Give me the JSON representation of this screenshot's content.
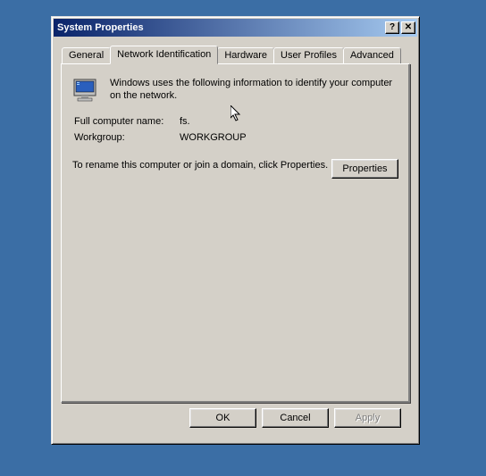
{
  "window": {
    "title": "System Properties"
  },
  "tabs": {
    "general": "General",
    "network": "Network Identification",
    "hardware": "Hardware",
    "userprofiles": "User Profiles",
    "advanced": "Advanced"
  },
  "panel": {
    "info": "Windows uses the following information to identify your computer on the network.",
    "fullname_label": "Full computer name:",
    "fullname_value": "fs.",
    "workgroup_label": "Workgroup:",
    "workgroup_value": "WORKGROUP",
    "rename_text": "To rename this computer or join a domain, click Properties.",
    "properties_btn": "Properties"
  },
  "footer": {
    "ok": "OK",
    "cancel": "Cancel",
    "apply": "Apply"
  },
  "titlebar": {
    "help": "?",
    "close": "✕"
  }
}
